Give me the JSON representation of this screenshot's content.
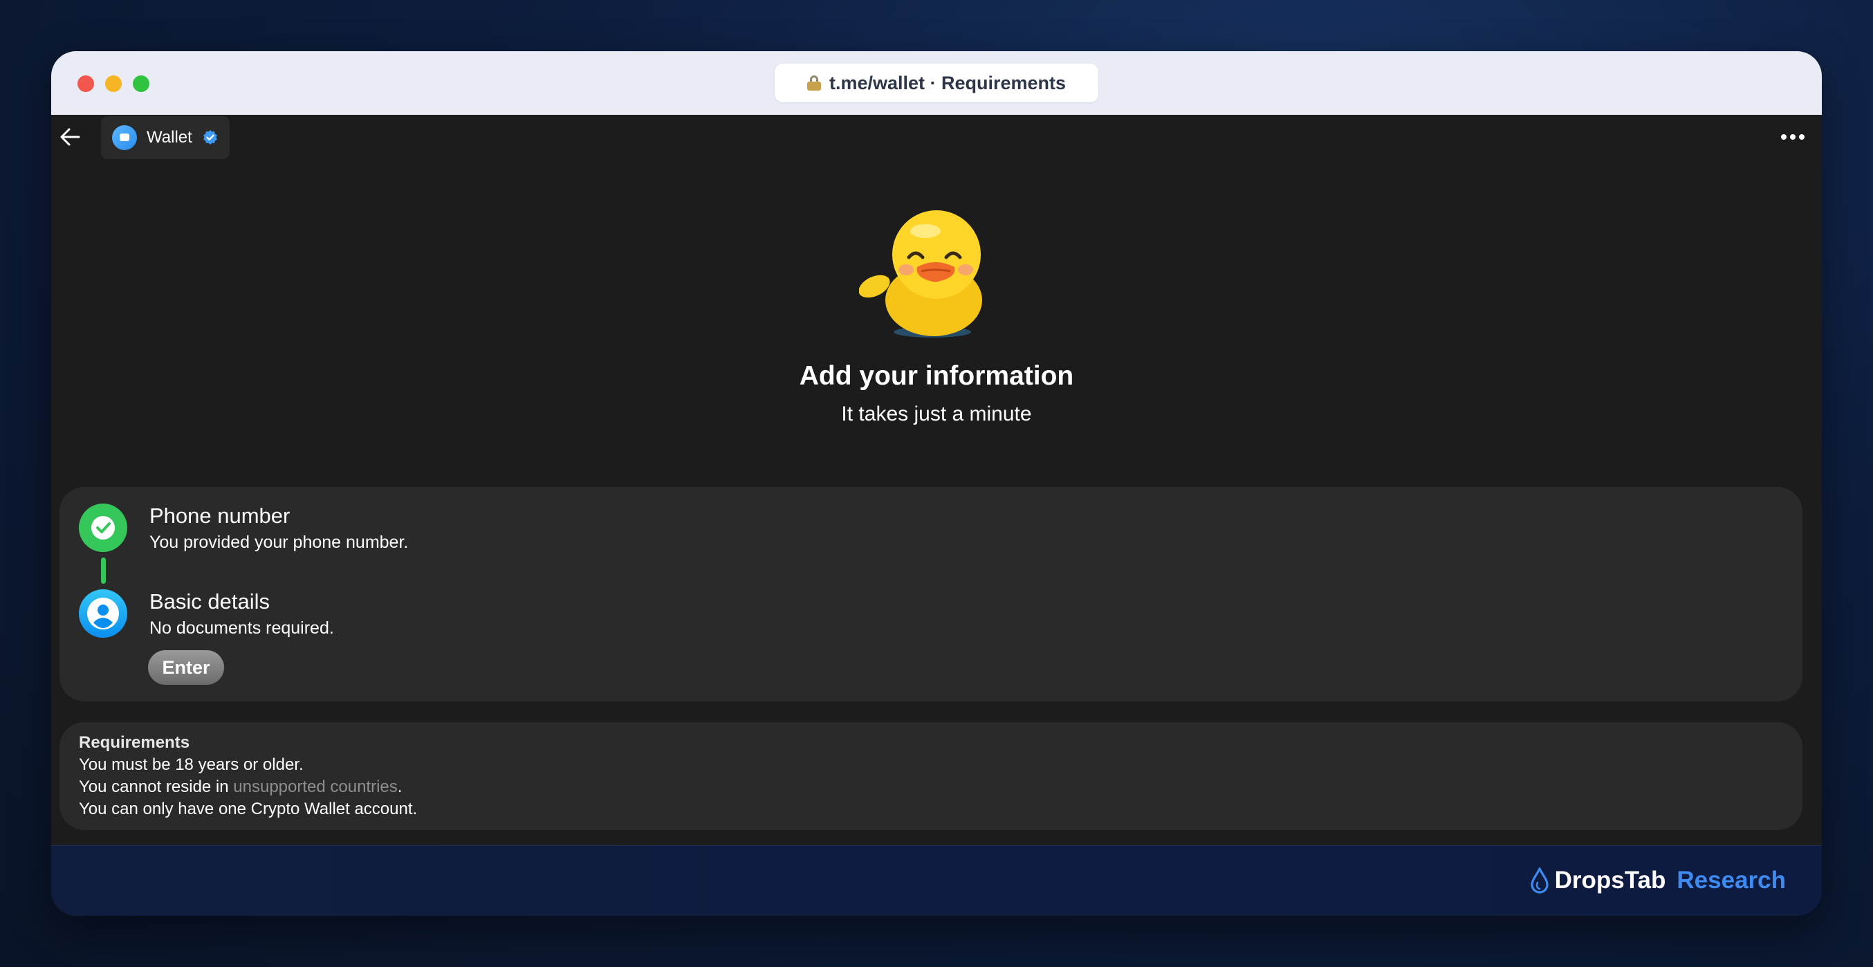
{
  "browser": {
    "url_title": "t.me/wallet · Requirements"
  },
  "appbar": {
    "app_name": "Wallet",
    "back_icon": "arrow-left-icon",
    "more_icon": "more-horizontal-icon"
  },
  "hero": {
    "image": "duck-sticker",
    "title": "Add your information",
    "subtitle": "It takes just a minute"
  },
  "steps": [
    {
      "title": "Phone number",
      "description": "You provided your phone number.",
      "status": "completed",
      "icon": "checkmark-icon"
    },
    {
      "title": "Basic details",
      "description": "No documents required.",
      "status": "current",
      "icon": "person-icon",
      "button_label": "Enter"
    }
  ],
  "requirements": {
    "title": "Requirements",
    "line1": "You must be 18 years or older.",
    "line2_prefix": "You cannot reside in ",
    "line2_link": "unsupported countries",
    "line2_suffix": ".",
    "line3": "You can only have one Crypto Wallet account."
  },
  "footer": {
    "brand_primary": "DropsTab",
    "brand_secondary": "Research"
  },
  "colors": {
    "success": "#35c759",
    "accent": "#0a8ff0",
    "brand_blue": "#3d8bf0",
    "surface": "#2a2a2a",
    "background": "#1c1c1c"
  }
}
